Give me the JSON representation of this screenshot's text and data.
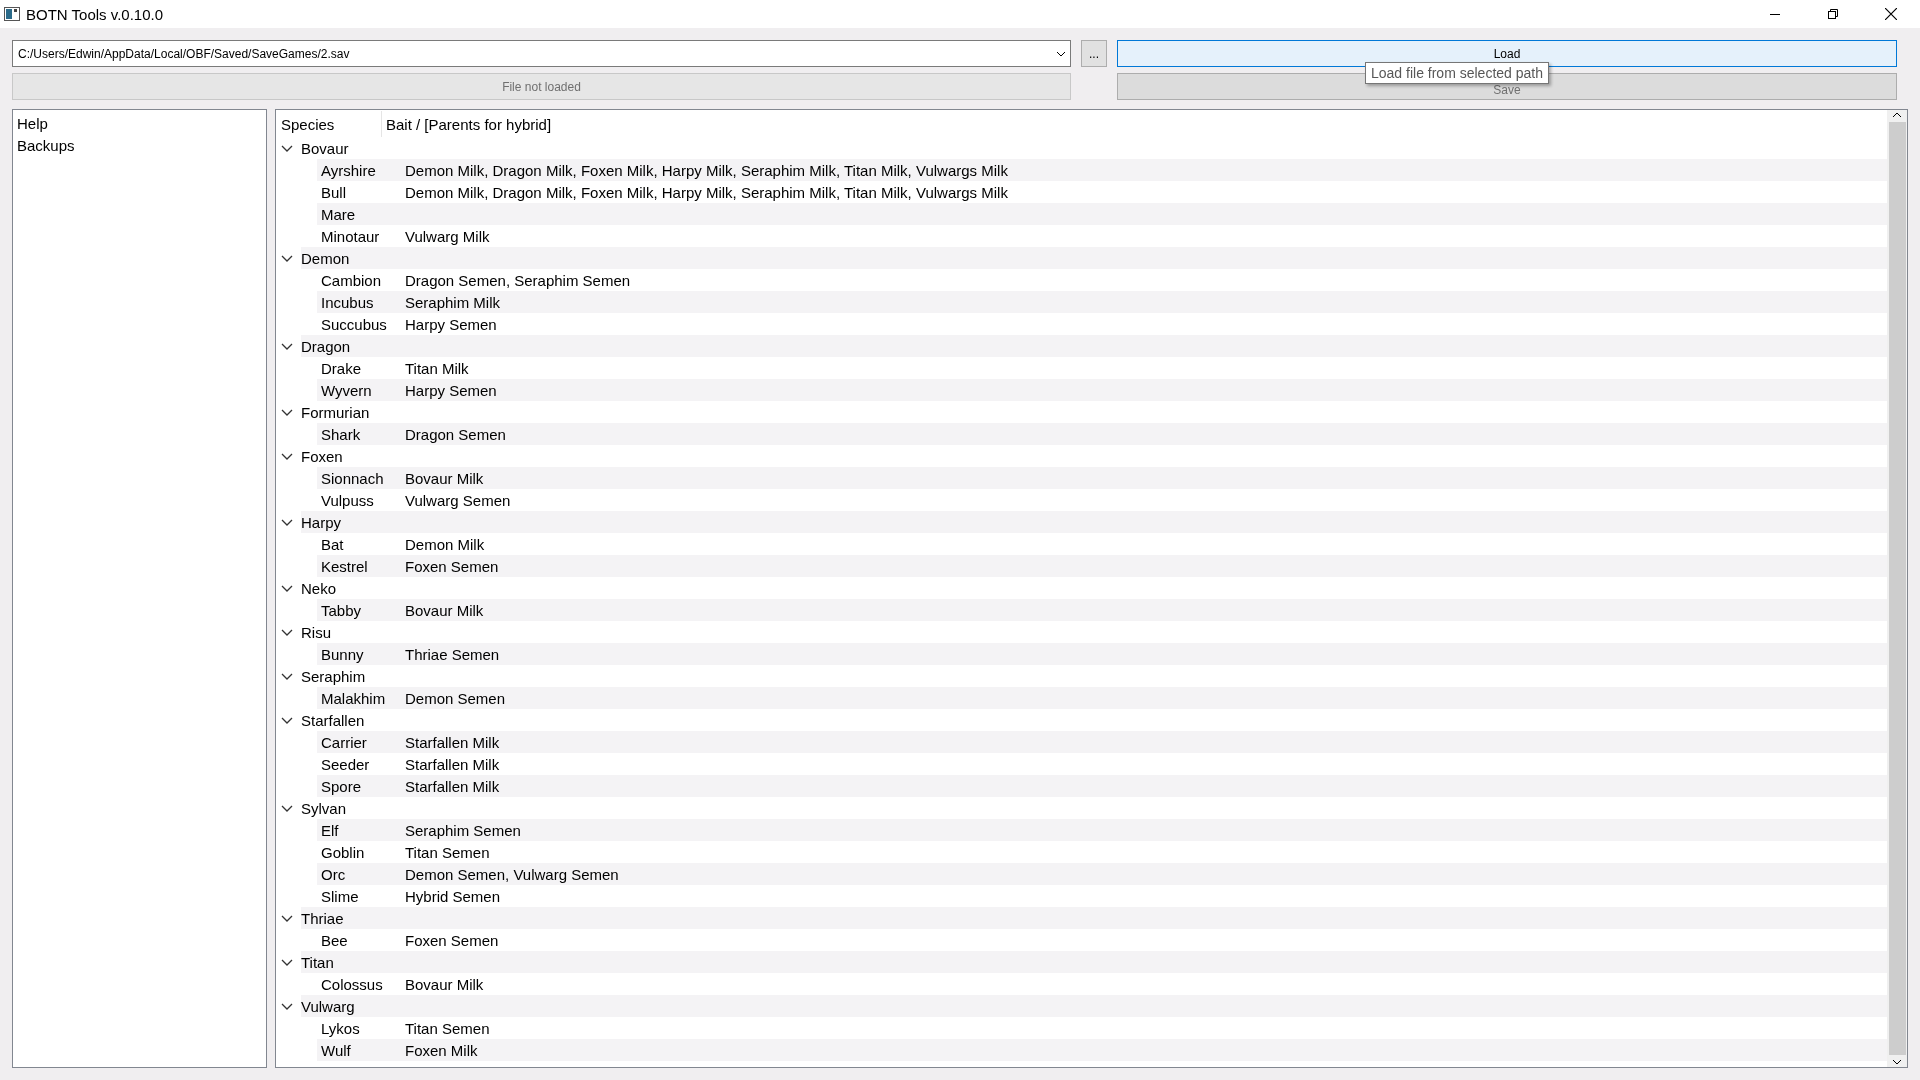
{
  "window": {
    "title": "BOTN Tools v.0.10.0"
  },
  "path_field": {
    "value": "C:/Users/Edwin/AppData/Local/OBF/Saved/SaveGames/2.sav"
  },
  "browse_button": {
    "label": "..."
  },
  "load_button": {
    "label": "Load",
    "focused": true
  },
  "save_button": {
    "label": "Save",
    "disabled": true
  },
  "status": {
    "text": "File not loaded"
  },
  "tooltip": {
    "text": "Load file from selected path"
  },
  "sidebar": {
    "items": [
      {
        "label": "Help"
      },
      {
        "label": "Backups"
      }
    ]
  },
  "tree": {
    "columns": [
      "Species",
      "Bait / [Parents for hybrid]"
    ],
    "groups": [
      {
        "name": "Bovaur",
        "expanded": true,
        "children": [
          {
            "name": "Ayrshire",
            "bait": "Demon Milk, Dragon Milk, Foxen Milk, Harpy Milk, Seraphim Milk, Titan Milk, Vulwargs Milk"
          },
          {
            "name": "Bull",
            "bait": "Demon Milk, Dragon Milk, Foxen Milk, Harpy Milk, Seraphim Milk, Titan Milk, Vulwargs Milk"
          },
          {
            "name": "Mare"
          },
          {
            "name": "Minotaur",
            "bait": "Vulwarg Milk"
          }
        ]
      },
      {
        "name": "Demon",
        "expanded": true,
        "children": [
          {
            "name": "Cambion",
            "bait": "Dragon Semen, Seraphim Semen"
          },
          {
            "name": "Incubus",
            "bait": "Seraphim Milk"
          },
          {
            "name": "Succubus",
            "bait": "Harpy Semen"
          }
        ]
      },
      {
        "name": "Dragon",
        "expanded": true,
        "children": [
          {
            "name": "Drake",
            "bait": "Titan Milk"
          },
          {
            "name": "Wyvern",
            "bait": "Harpy Semen"
          }
        ]
      },
      {
        "name": "Formurian",
        "expanded": true,
        "children": [
          {
            "name": "Shark",
            "bait": "Dragon Semen"
          }
        ]
      },
      {
        "name": "Foxen",
        "expanded": true,
        "children": [
          {
            "name": "Sionnach",
            "bait": "Bovaur Milk"
          },
          {
            "name": "Vulpuss",
            "bait": "Vulwarg Semen"
          }
        ]
      },
      {
        "name": "Harpy",
        "expanded": true,
        "children": [
          {
            "name": "Bat",
            "bait": "Demon Milk"
          },
          {
            "name": "Kestrel",
            "bait": "Foxen Semen"
          }
        ]
      },
      {
        "name": "Neko",
        "expanded": true,
        "children": [
          {
            "name": "Tabby",
            "bait": "Bovaur Milk"
          }
        ]
      },
      {
        "name": "Risu",
        "expanded": true,
        "children": [
          {
            "name": "Bunny",
            "bait": "Thriae Semen"
          }
        ]
      },
      {
        "name": "Seraphim",
        "expanded": true,
        "children": [
          {
            "name": "Malakhim",
            "bait": "Demon Semen"
          }
        ]
      },
      {
        "name": "Starfallen",
        "expanded": true,
        "children": [
          {
            "name": "Carrier",
            "bait": "Starfallen Milk"
          },
          {
            "name": "Seeder",
            "bait": "Starfallen Milk"
          },
          {
            "name": "Spore",
            "bait": "Starfallen Milk"
          }
        ]
      },
      {
        "name": "Sylvan",
        "expanded": true,
        "children": [
          {
            "name": "Elf",
            "bait": "Seraphim Semen"
          },
          {
            "name": "Goblin",
            "bait": "Titan Semen"
          },
          {
            "name": "Orc",
            "bait": "Demon Semen, Vulwarg Semen"
          },
          {
            "name": "Slime",
            "bait": "Hybrid Semen"
          }
        ]
      },
      {
        "name": "Thriae",
        "expanded": true,
        "children": [
          {
            "name": "Bee",
            "bait": "Foxen Semen"
          }
        ]
      },
      {
        "name": "Titan",
        "expanded": true,
        "children": [
          {
            "name": "Colossus",
            "bait": "Bovaur Milk"
          }
        ]
      },
      {
        "name": "Vulwarg",
        "expanded": true,
        "children": [
          {
            "name": "Lykos",
            "bait": "Titan Semen"
          },
          {
            "name": "Wulf",
            "bait": "Foxen Milk"
          }
        ]
      }
    ]
  }
}
